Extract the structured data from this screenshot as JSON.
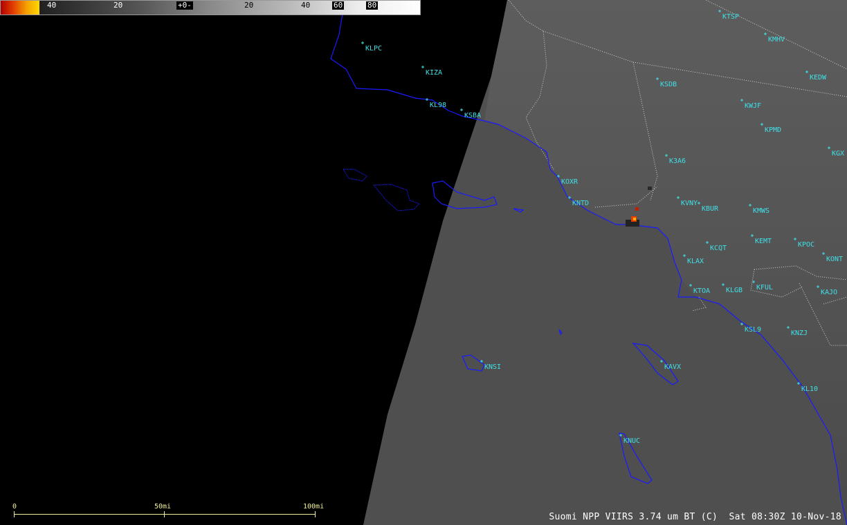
{
  "colorbar": {
    "ticks": [
      {
        "label": "40",
        "style": "plain"
      },
      {
        "label": "20",
        "style": "plain"
      },
      {
        "label": "+0-",
        "style": "box"
      },
      {
        "label": "20",
        "style": "dark"
      },
      {
        "label": "40",
        "style": "dark"
      },
      {
        "label": "60",
        "style": "box"
      },
      {
        "label": "80",
        "style": "box"
      }
    ],
    "colors": {
      "fire_low": "#b00000",
      "fire_high": "#ffd800",
      "cold": "#000000",
      "warm": "#ffffff"
    }
  },
  "stations": [
    {
      "id": "KTSP"
    },
    {
      "id": "KMHV"
    },
    {
      "id": "KEDW"
    },
    {
      "id": "KLPC"
    },
    {
      "id": "KIZA"
    },
    {
      "id": "KSDB"
    },
    {
      "id": "KL98"
    },
    {
      "id": "KSBA"
    },
    {
      "id": "KWJF"
    },
    {
      "id": "KPMD"
    },
    {
      "id": "KGX"
    },
    {
      "id": "K3A6"
    },
    {
      "id": "KOXR"
    },
    {
      "id": "KNTD"
    },
    {
      "id": "KVNY"
    },
    {
      "id": "KBUR"
    },
    {
      "id": "KMWS"
    },
    {
      "id": "KEMT"
    },
    {
      "id": "KPOC"
    },
    {
      "id": "KCQT"
    },
    {
      "id": "KONT"
    },
    {
      "id": "KLAX"
    },
    {
      "id": "KTOA"
    },
    {
      "id": "KLGB"
    },
    {
      "id": "KFUL"
    },
    {
      "id": "KAJO"
    },
    {
      "id": "KSL9"
    },
    {
      "id": "KNZJ"
    },
    {
      "id": "KNSI"
    },
    {
      "id": "KAVX"
    },
    {
      "id": "KL10"
    },
    {
      "id": "KNUC"
    }
  ],
  "scalebar": {
    "labels": [
      "0",
      "50mi",
      "100mi"
    ]
  },
  "caption": {
    "product": "Suomi NPP VIIRS 3.74 um BT (C)",
    "time": "Sat 08:30Z 10-Nov-18"
  },
  "colors": {
    "coastline": "#1a1aff",
    "station": "#3fe0e8",
    "borders": "#cfcfcf",
    "scalebar": "#f0f0a0"
  }
}
